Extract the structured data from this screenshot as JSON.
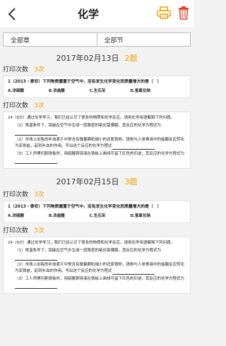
{
  "nav": {
    "title": "化学"
  },
  "filters": {
    "department": "全部章",
    "section": "全部节"
  },
  "days": [
    {
      "date": "2017年02月13日",
      "count": "2题",
      "records": [
        {
          "print_label": "打印次数",
          "print_count": "3次",
          "question": "1（2013・泰安）下列物质露置于空气中，没有发生化学变化而质量增大的是（　）",
          "options": [
            "A.浓硫酸",
            "B.浓盐酸",
            "C.生石灰",
            "D.氢氧化钠"
          ]
        },
        {
          "print_label": "打印次数",
          "print_count": "3次",
          "q_head": "24（9分）通过化学学习，我们已经认识了很多的物质和化学反应。请用化学用语解释下列问题。",
          "q1": "（1）常温条件下，铝能在空气中生成一层致密的氧化铝薄膜，其反应的化学方程式为",
          "q2": "（2）市场上出售的补血麦片中常含有微量颗粒细小的还原铁粉，铁粉与人体胃液中的盐酸反应转化为亚铁盐，起到补血的作用。写出这个反应的化学方程式",
          "q3": "（3）工人师傅切割铁板时，用硫酸铜溶液在铁板上画线可留下红色的印迹，其反应的化学方程式为"
        }
      ]
    },
    {
      "date": "2017年02月15日",
      "count": "3题",
      "records": [
        {
          "print_label": "打印次数",
          "print_count": "3次",
          "question": "1（2013・泰安）下列物质露置于空气中，没有发生化学变化而质量增大的是（　）",
          "options": [
            "A.浓硫酸",
            "B.浓盐酸",
            "C.生石灰",
            "D.氢氧化钠"
          ]
        },
        {
          "print_label": "打印次数",
          "print_count": "3次",
          "q_head": "24（9分）通过化学学习，我们已经认识了很多的物质和化学反应。请用化学用语解释下列问题。",
          "q1": "（1）常温条件下，铝能在空气中生成一层致密的氧化铝薄膜，其反应的化学方程式为",
          "q2": "（2）市场上出售的补血麦片中常含有微量颗粒细小的还原铁粉，铁粉与人体胃液中的盐酸反应转化为亚铁盐，起到补血的作用。写出这个反应的化学方程式",
          "q3": "（3）工人师傅切割铁板时，用硫酸铜溶液在铁板上画线可留下红色的印迹，其反应的化学方程式为"
        }
      ]
    }
  ],
  "colors": {
    "accent": "#f0a000",
    "danger": "#e0442a"
  }
}
